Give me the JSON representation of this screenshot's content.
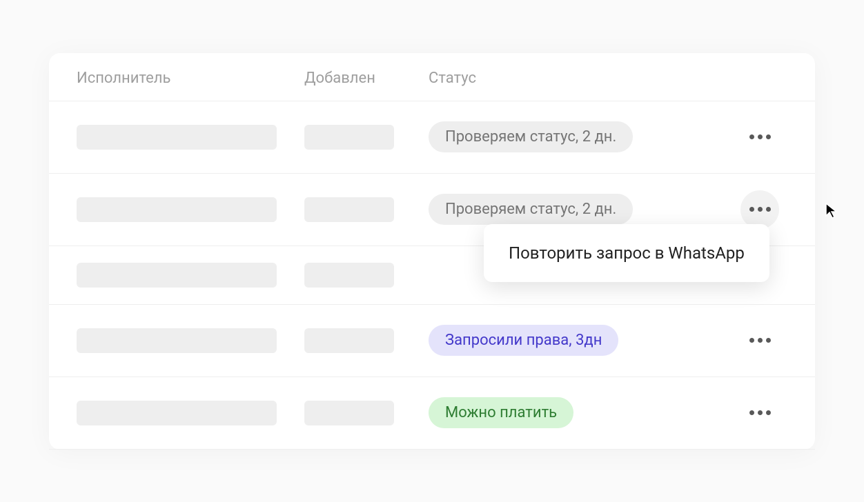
{
  "headers": {
    "executor": "Исполнитель",
    "added": "Добавлен",
    "status": "Статус"
  },
  "rows": [
    {
      "status_label": "Проверяем статус, 2 дн.",
      "status_type": "gray",
      "active": false
    },
    {
      "status_label": "Проверяем статус, 2 дн.",
      "status_type": "gray",
      "active": true
    },
    {
      "status_label": "",
      "status_type": "none",
      "active": false
    },
    {
      "status_label": "Запросили права, 3дн",
      "status_type": "purple",
      "active": false
    },
    {
      "status_label": "Можно платить",
      "status_type": "green",
      "active": false
    }
  ],
  "popup": {
    "item": "Повторить запрос в WhatsApp"
  }
}
